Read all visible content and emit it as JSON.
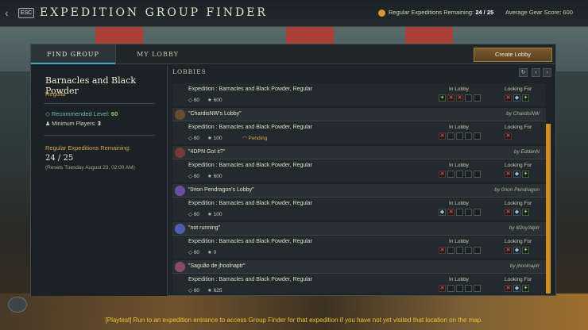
{
  "header": {
    "back_icon": "chevron-left-icon",
    "esc_label": "ESC",
    "title": "EXPEDITION GROUP FINDER",
    "remaining_label": "Regular Expeditions Remaining:",
    "remaining_value": "24 / 25",
    "gear_score": "Average Gear Score: 600"
  },
  "tabs": [
    {
      "label": "FIND GROUP",
      "active": true
    },
    {
      "label": "MY LOBBY",
      "active": false
    }
  ],
  "create_lobby_label": "Create Lobby",
  "expedition": {
    "name": "Barnacles and Black Powder",
    "difficulty": "Regular",
    "recommended_label": "Recommended Level:",
    "recommended_value": "60",
    "min_players_label": "Minimum Players:",
    "min_players_value": "3",
    "remaining_label": "Regular Expeditions Remaining:",
    "remaining_value": "24 / 25",
    "reset_text": "(Resets Tuesday August 23, 02:00 AM)"
  },
  "lobbies_header": "LOBBIES",
  "columns": {
    "in_lobby": "In Lobby",
    "looking_for": "Looking For"
  },
  "lobbies": [
    {
      "name": "",
      "owner": "",
      "expedition": "Expedition : Barnacles and Black Powder, Regular",
      "level": "60",
      "gear": "600",
      "pending": "",
      "in_lobby": [
        "g",
        "x",
        "x",
        "e",
        "e"
      ],
      "looking_for": [
        "x",
        "s",
        "g"
      ]
    },
    {
      "name": "\"ChardisNW's Lobby\"",
      "owner": "by ChardisNW",
      "expedition": "Expedition : Barnacles and Black Powder, Regular",
      "level": "60",
      "gear": "100",
      "pending": "Pending",
      "in_lobby": [
        "x",
        "e",
        "e",
        "e",
        "e"
      ],
      "looking_for": [
        "x"
      ]
    },
    {
      "name": "\"4DPN Got it?\"",
      "owner": "by EddanN",
      "expedition": "Expedition : Barnacles and Black Powder, Regular",
      "level": "60",
      "gear": "600",
      "pending": "",
      "in_lobby": [
        "x",
        "e",
        "e",
        "e",
        "e"
      ],
      "looking_for": [
        "x",
        "s",
        "g"
      ]
    },
    {
      "name": "\"0rion Pendragon's Lobby\"",
      "owner": "by 0rion Pendragon",
      "expedition": "Expedition : Barnacles and Black Powder, Regular",
      "level": "60",
      "gear": "100",
      "pending": "",
      "in_lobby": [
        "s",
        "x",
        "e",
        "e",
        "e"
      ],
      "looking_for": [
        "x",
        "s",
        "g"
      ]
    },
    {
      "name": "\"not running\"",
      "owner": "by lll2oy3dptr",
      "expedition": "Expedition : Barnacles and Black Powder, Regular",
      "level": "60",
      "gear": "0",
      "pending": "",
      "in_lobby": [
        "x",
        "e",
        "e",
        "e",
        "e"
      ],
      "looking_for": [
        "x",
        "s",
        "g"
      ]
    },
    {
      "name": "\"Saguão de jhoolnaptr\"",
      "owner": "by jhoolnaptr",
      "expedition": "Expedition : Barnacles and Black Powder, Regular",
      "level": "60",
      "gear": "625",
      "pending": "",
      "in_lobby": [
        "x",
        "e",
        "e",
        "e",
        "e"
      ],
      "looking_for": [
        "x",
        "s",
        "g"
      ]
    }
  ],
  "tip": "[Playtest] Run to an expedition entrance to access Group Finder for that expedition if you have not yet visited that location on the map.",
  "colors": {
    "accent": "#d0901f",
    "active_tab": "#4aa3c8",
    "tip": "#e8c234"
  }
}
